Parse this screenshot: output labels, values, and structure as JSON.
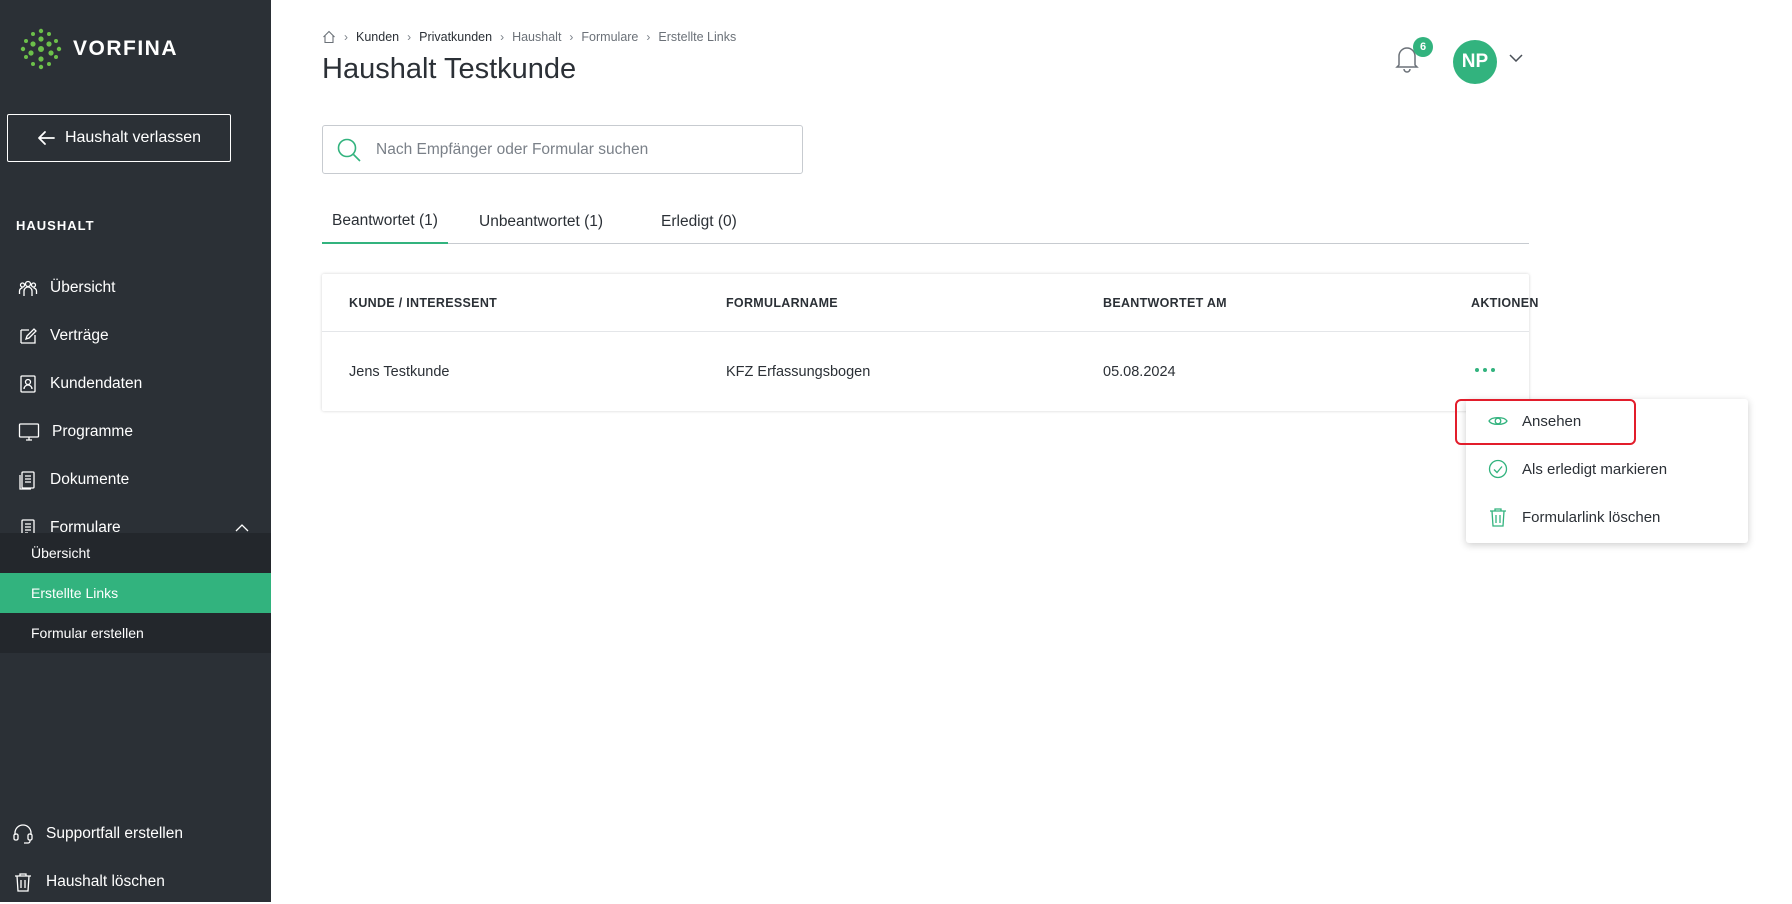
{
  "brand": {
    "name": "VORFINA",
    "accent": "#32b37e",
    "sidebar_bg": "#2b3036"
  },
  "sidebar": {
    "leave_button": "Haushalt verlassen",
    "section_label": "HAUSHALT",
    "items": [
      {
        "label": "Übersicht",
        "icon": "people-icon"
      },
      {
        "label": "Verträge",
        "icon": "edit-icon"
      },
      {
        "label": "Kundendaten",
        "icon": "contact-card-icon"
      },
      {
        "label": "Programme",
        "icon": "monitor-icon"
      },
      {
        "label": "Dokumente",
        "icon": "document-icon"
      },
      {
        "label": "Formulare",
        "icon": "form-icon",
        "expanded": true
      }
    ],
    "sub_items": [
      {
        "label": "Übersicht",
        "active": false
      },
      {
        "label": "Erstellte Links",
        "active": true
      },
      {
        "label": "Formular erstellen",
        "active": false
      }
    ],
    "bottom_items": [
      {
        "label": "Supportfall erstellen",
        "icon": "headset-icon"
      },
      {
        "label": "Haushalt löschen",
        "icon": "trash-icon"
      }
    ]
  },
  "breadcrumb": [
    "Kunden",
    "Privatkunden",
    "Haushalt",
    "Formulare",
    "Erstellte Links"
  ],
  "page_title": "Haushalt Testkunde",
  "header": {
    "notification_count": "6",
    "avatar_initials": "NP"
  },
  "search": {
    "placeholder": "Nach Empfänger oder Formular suchen",
    "value": ""
  },
  "tabs": [
    {
      "label": "Beantwortet (1)",
      "active": true
    },
    {
      "label": "Unbeantwortet (1)",
      "active": false
    },
    {
      "label": "Erledigt (0)",
      "active": false
    }
  ],
  "table": {
    "columns": [
      "KUNDE / INTERESSENT",
      "FORMULARNAME",
      "BEANTWORTET AM",
      "AKTIONEN"
    ],
    "rows": [
      {
        "kunde": "Jens Testkunde",
        "formular": "KFZ Erfassungsbogen",
        "datum": "05.08.2024"
      }
    ]
  },
  "actions_menu": {
    "items": [
      {
        "label": "Ansehen",
        "icon": "eye-icon"
      },
      {
        "label": "Als erledigt markieren",
        "icon": "check-circle-icon"
      },
      {
        "label": "Formularlink löschen",
        "icon": "trash-icon"
      }
    ],
    "highlight_color": "#e21d2b"
  }
}
